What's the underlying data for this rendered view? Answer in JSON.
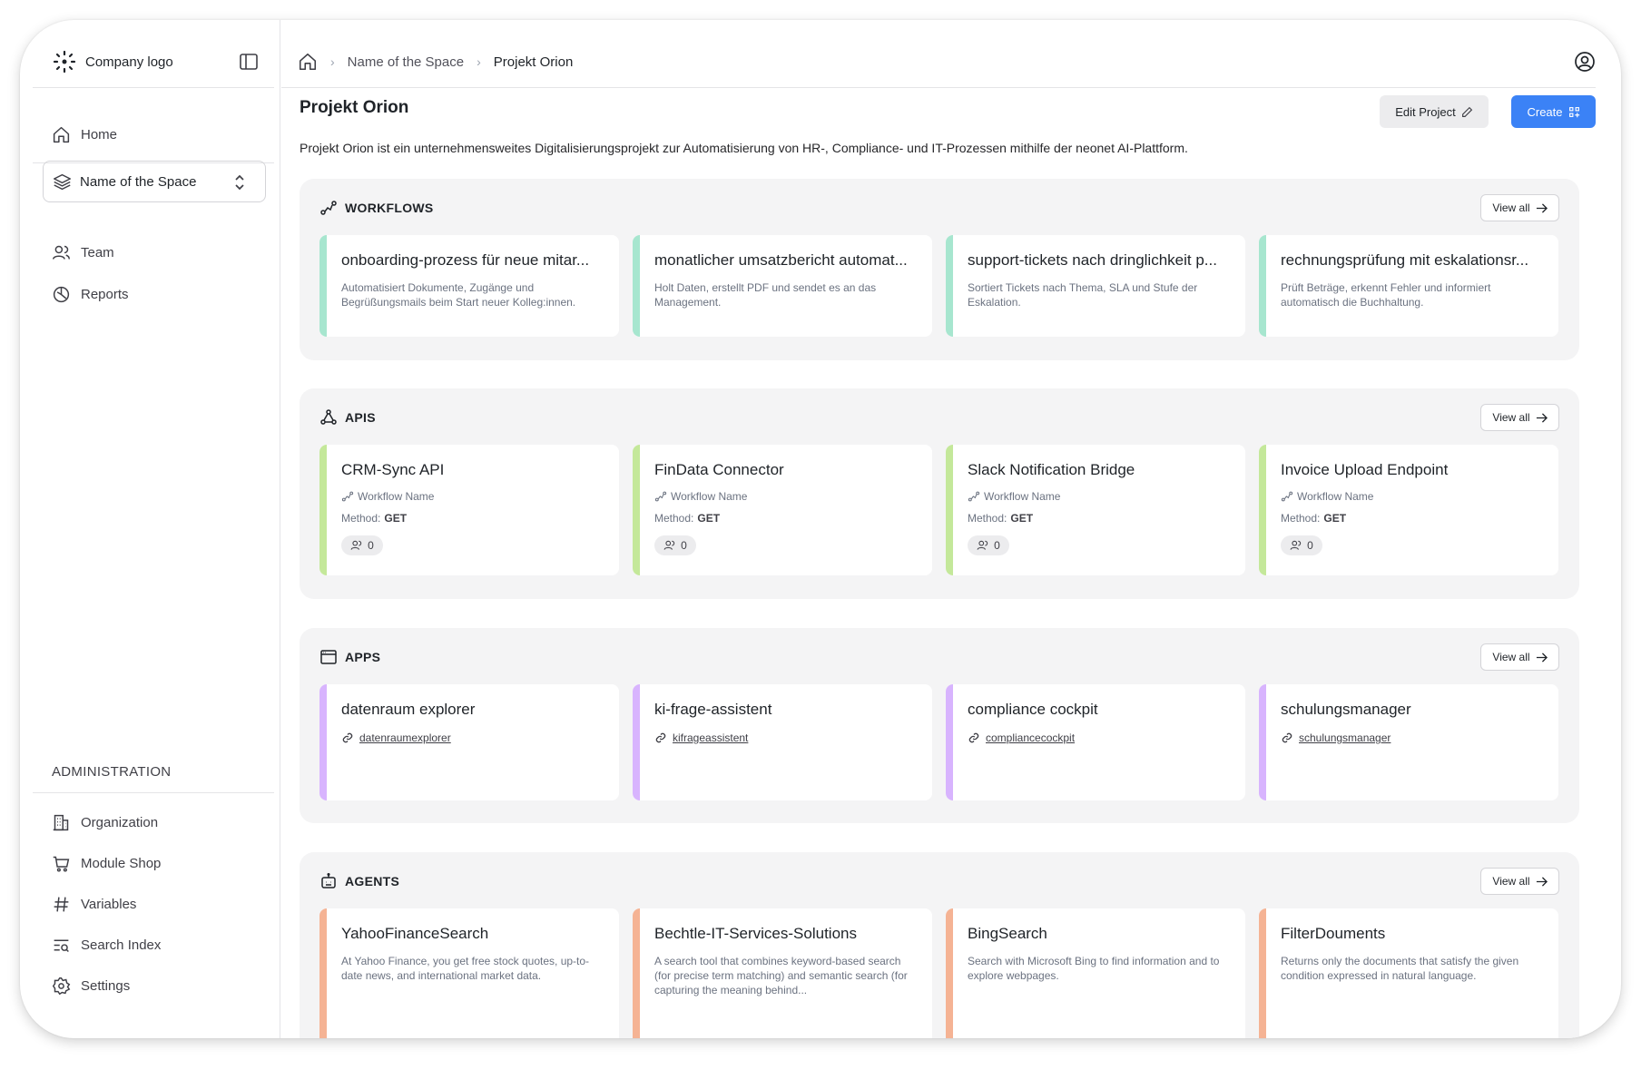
{
  "sidebar": {
    "logo_text": "Company logo",
    "nav": [
      {
        "label": "Home",
        "icon": "home-icon"
      },
      {
        "label": "Team",
        "icon": "team-icon"
      },
      {
        "label": "Reports",
        "icon": "reports-icon"
      }
    ],
    "space_selector": {
      "label": "Name of the Space",
      "icon": "layers-icon"
    },
    "admin": {
      "title": "ADMINISTRATION",
      "items": [
        {
          "label": "Organization",
          "icon": "building-icon"
        },
        {
          "label": "Module Shop",
          "icon": "cart-icon"
        },
        {
          "label": "Variables",
          "icon": "hash-icon"
        },
        {
          "label": "Search Index",
          "icon": "search-index-icon"
        },
        {
          "label": "Settings",
          "icon": "gear-icon"
        }
      ]
    }
  },
  "breadcrumb": {
    "space": "Name of the Space",
    "current": "Projekt Orion"
  },
  "page": {
    "title": "Projekt Orion",
    "description": "Projekt Orion ist ein unternehmensweites Digitalisierungsprojekt zur Automatisierung von HR-, Compliance- und IT-Prozessen mithilfe der neonet AI-Plattform.",
    "edit_label": "Edit Project",
    "create_label": "Create"
  },
  "view_all_label": "View all",
  "accent_colors": {
    "workflows": "#a7e6cf",
    "apis": "#c4e89a",
    "apps": "#d8b4fe",
    "agents": "#f5b394",
    "primary": "#3b82f6"
  },
  "workflows": {
    "title": "WORKFLOWS",
    "items": [
      {
        "title": "onboarding-prozess für neue mitar...",
        "desc": "Automatisiert Dokumente, Zugänge und Begrüßungsmails beim Start neuer Kolleg:innen."
      },
      {
        "title": "monatlicher umsatzbericht automat...",
        "desc": "Holt Daten, erstellt PDF und sendet es an das Management."
      },
      {
        "title": "support-tickets nach dringlichkeit p...",
        "desc": "Sortiert Tickets nach Thema, SLA und Stufe der Eskalation."
      },
      {
        "title": "rechnungsprüfung mit eskalationsr...",
        "desc": "Prüft Beträge, erkennt Fehler und informiert automatisch die Buchhaltung."
      }
    ]
  },
  "apis": {
    "title": "APIS",
    "items": [
      {
        "title": "CRM-Sync API",
        "workflow": "Workflow Name",
        "method_label": "Method:",
        "method": "GET",
        "count": "0"
      },
      {
        "title": "FinData Connector",
        "workflow": "Workflow Name",
        "method_label": "Method:",
        "method": "GET",
        "count": "0"
      },
      {
        "title": "Slack Notification Bridge",
        "workflow": "Workflow Name",
        "method_label": "Method:",
        "method": "GET",
        "count": "0"
      },
      {
        "title": "Invoice Upload Endpoint",
        "workflow": "Workflow Name",
        "method_label": "Method:",
        "method": "GET",
        "count": "0"
      }
    ]
  },
  "apps": {
    "title": "APPS",
    "items": [
      {
        "title": "datenraum explorer",
        "link": "datenraumexplorer"
      },
      {
        "title": "ki-frage-assistent",
        "link": "kifrageassistent"
      },
      {
        "title": "compliance cockpit",
        "link": "compliancecockpit"
      },
      {
        "title": "schulungsmanager",
        "link": "schulungsmanager"
      }
    ]
  },
  "agents": {
    "title": "AGENTS",
    "items": [
      {
        "title": "YahooFinanceSearch",
        "desc": "At Yahoo Finance, you get free stock quotes, up-to-date news, and international market data."
      },
      {
        "title": "Bechtle-IT-Services-Solutions",
        "desc": "A search tool that combines keyword-based search (for precise term matching) and semantic search (for capturing the meaning behind..."
      },
      {
        "title": "BingSearch",
        "desc": "Search with Microsoft Bing to find information and to explore webpages."
      },
      {
        "title": "FilterDouments",
        "desc": "Returns only the documents that satisfy the given condition expressed in natural language."
      }
    ]
  }
}
